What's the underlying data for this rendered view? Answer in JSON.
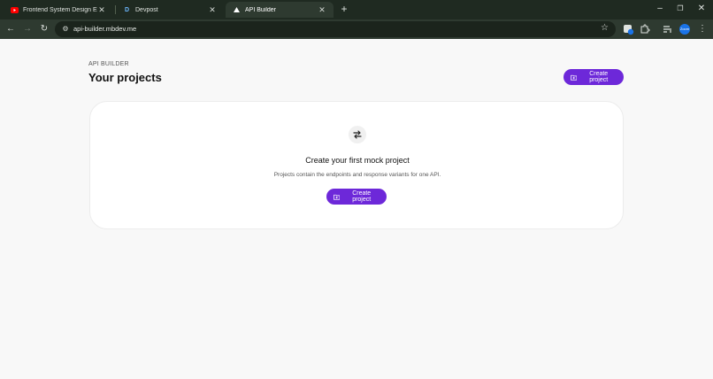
{
  "browser": {
    "tabs": [
      {
        "title": "Frontend System Design Explai",
        "favicon": "youtube-icon",
        "active": false
      },
      {
        "title": "Devpost",
        "favicon": "devpost-icon",
        "active": false
      },
      {
        "title": "API Builder",
        "favicon": "triangle-icon",
        "active": true
      }
    ],
    "url": "api-builder.mbdev.me",
    "profile_label": "Zoom"
  },
  "header": {
    "eyebrow": "API BUILDER",
    "title": "Your projects",
    "create_button_label": "Create project"
  },
  "empty_state": {
    "icon": "arrows-exchange-icon",
    "title": "Create your first mock project",
    "description": "Projects contain the endpoints and response variants for one API.",
    "create_button_label": "Create project"
  },
  "colors": {
    "accent": "#6d28d9",
    "chrome_dark": "#1f2a21",
    "chrome_toolbar": "#2e3a30",
    "page_bg": "#f8f8f8"
  }
}
